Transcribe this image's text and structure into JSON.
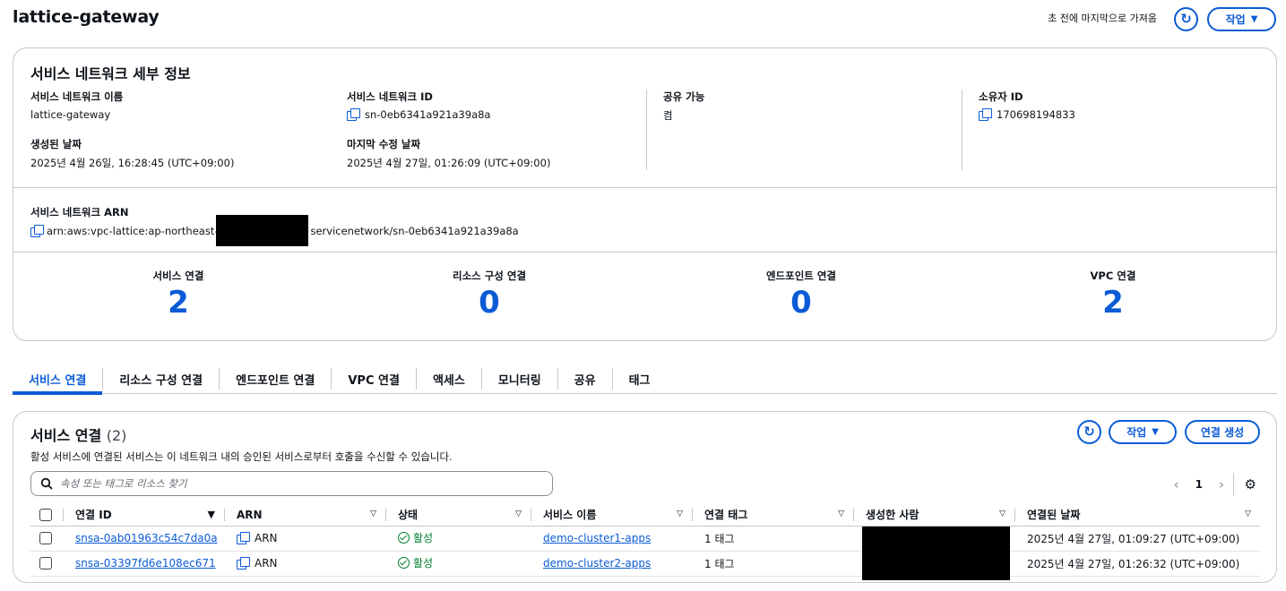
{
  "header": {
    "title": "lattice-gateway",
    "last_fetched": "초 전에 마지막으로 가져옴",
    "actions_label": "작업"
  },
  "details": {
    "title": "서비스 네트워크 세부 정보",
    "name_label": "서비스 네트워크 이름",
    "name_value": "lattice-gateway",
    "created_label": "생성된 날짜",
    "created_value": "2025년 4월 26일, 16:28:45 (UTC+09:00)",
    "id_label": "서비스 네트워크 ID",
    "id_value": "sn-0eb6341a921a39a8a",
    "modified_label": "마지막 수정 날짜",
    "modified_value": "2025년 4월 27일, 01:26:09 (UTC+09:00)",
    "shareable_label": "공유 가능",
    "shareable_value": "켬",
    "owner_label": "소유자 ID",
    "owner_value": "170698194833",
    "arn_label": "서비스 네트워크 ARN",
    "arn_prefix": "arn:aws:vpc-lattice:ap-northeast-",
    "arn_suffix": "servicenetwork/sn-0eb6341a921a39a8a"
  },
  "counts": [
    {
      "label": "서비스 연결",
      "value": "2"
    },
    {
      "label": "리소스 구성 연결",
      "value": "0"
    },
    {
      "label": "엔드포인트 연결",
      "value": "0"
    },
    {
      "label": "VPC 연결",
      "value": "2"
    }
  ],
  "tabs": [
    "서비스 연결",
    "리소스 구성 연결",
    "엔드포인트 연결",
    "VPC 연결",
    "액세스",
    "모니터링",
    "공유",
    "태그"
  ],
  "panel": {
    "title": "서비스 연결",
    "count": "(2)",
    "description": "활성 서비스에 연결된 서비스는 이 네트워크 내의 승인된 서비스로부터 호출을 수신할 수 있습니다.",
    "actions_label": "작업",
    "create_label": "연결 생성",
    "search_placeholder": "속성 또는 태그로 리소스 찾기",
    "page": "1",
    "columns": [
      "연결 ID",
      "ARN",
      "상태",
      "서비스 이름",
      "연결 태그",
      "생성한 사람",
      "연결된 날짜"
    ],
    "rows": [
      {
        "id": "snsa-0ab01963c54c7da0a",
        "arn": "ARN",
        "status": "활성",
        "service": "demo-cluster1-apps",
        "tags": "1 태그",
        "date": "2025년 4월 27일, 01:09:27 (UTC+09:00)"
      },
      {
        "id": "snsa-03397fd6e108ec671",
        "arn": "ARN",
        "status": "활성",
        "service": "demo-cluster2-apps",
        "tags": "1 태그",
        "date": "2025년 4월 27일, 01:26:32 (UTC+09:00)"
      }
    ]
  }
}
